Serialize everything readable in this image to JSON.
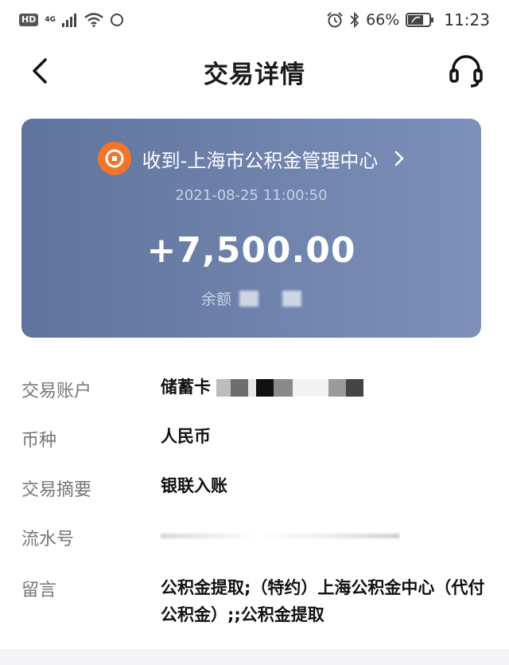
{
  "status_bar": {
    "hd": "HD",
    "network": "4G",
    "battery": "66%",
    "time": "11:23"
  },
  "nav": {
    "title": "交易详情"
  },
  "card": {
    "payee": "收到-上海市公积金管理中心",
    "time": "2021-08-25 11:00:50",
    "amount": "+7,500.00",
    "balance_label": "余额",
    "colors": {
      "start": "#5f739d",
      "end": "#7c90ba",
      "logo": "#f4742a"
    }
  },
  "details": [
    {
      "label": "交易账户",
      "value": "储蓄卡"
    },
    {
      "label": "币种",
      "value": "人民币"
    },
    {
      "label": "交易摘要",
      "value": "银联入账"
    },
    {
      "label": "流水号",
      "value": ""
    },
    {
      "label": "留言",
      "value": "公积金提取;（特约）上海公积金中心（代付公积金）;;公积金提取"
    }
  ],
  "icons": {
    "back": "chevron-left-icon",
    "service": "headset-icon",
    "payee": "bank-logo-icon"
  }
}
